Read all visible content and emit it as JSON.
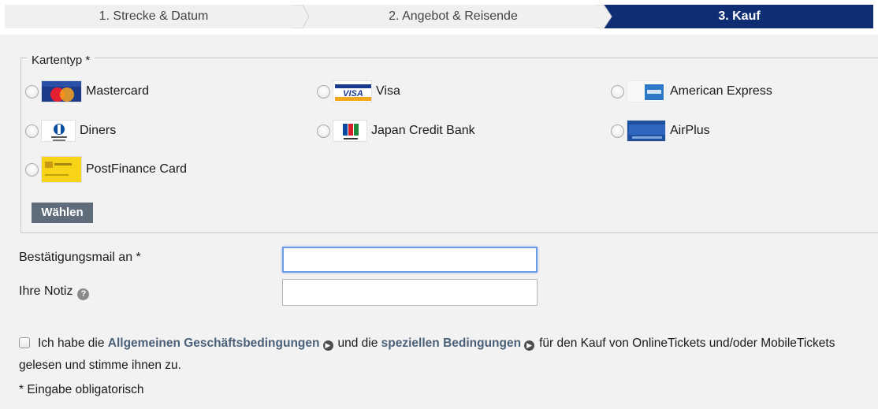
{
  "steps": [
    {
      "label": "1. Strecke & Datum"
    },
    {
      "label": "2. Angebot & Reisende"
    },
    {
      "label": "3. Kauf"
    }
  ],
  "card_type": {
    "legend": "Kartentyp *",
    "options": [
      {
        "label": "Mastercard",
        "icon": "mastercard-logo-icon"
      },
      {
        "label": "Visa",
        "icon": "visa-logo-icon"
      },
      {
        "label": "American Express",
        "icon": "amex-logo-icon"
      },
      {
        "label": "Diners",
        "icon": "diners-logo-icon"
      },
      {
        "label": "Japan Credit Bank",
        "icon": "jcb-logo-icon"
      },
      {
        "label": "AirPlus",
        "icon": "airplus-logo-icon"
      },
      {
        "label": "PostFinance Card",
        "icon": "postfinance-logo-icon"
      }
    ],
    "choose_button": "Wählen"
  },
  "form": {
    "email_label": "Bestätigungsmail an *",
    "email_value": "",
    "note_label": "Ihre Notiz",
    "note_value": ""
  },
  "agb": {
    "prefix": "Ich habe die",
    "link1": "Allgemeinen Geschäftsbedingungen",
    "middle": "und die",
    "link2": "speziellen Bedingungen",
    "suffix": "für den Kauf von OnlineTickets und/oder MobileTickets gelesen und stimme ihnen zu."
  },
  "mandatory_note": "* Eingabe obligatorisch",
  "colors": {
    "active_step": "#0e2d73",
    "button": "#5f6d7a",
    "link": "#4a5f78"
  }
}
